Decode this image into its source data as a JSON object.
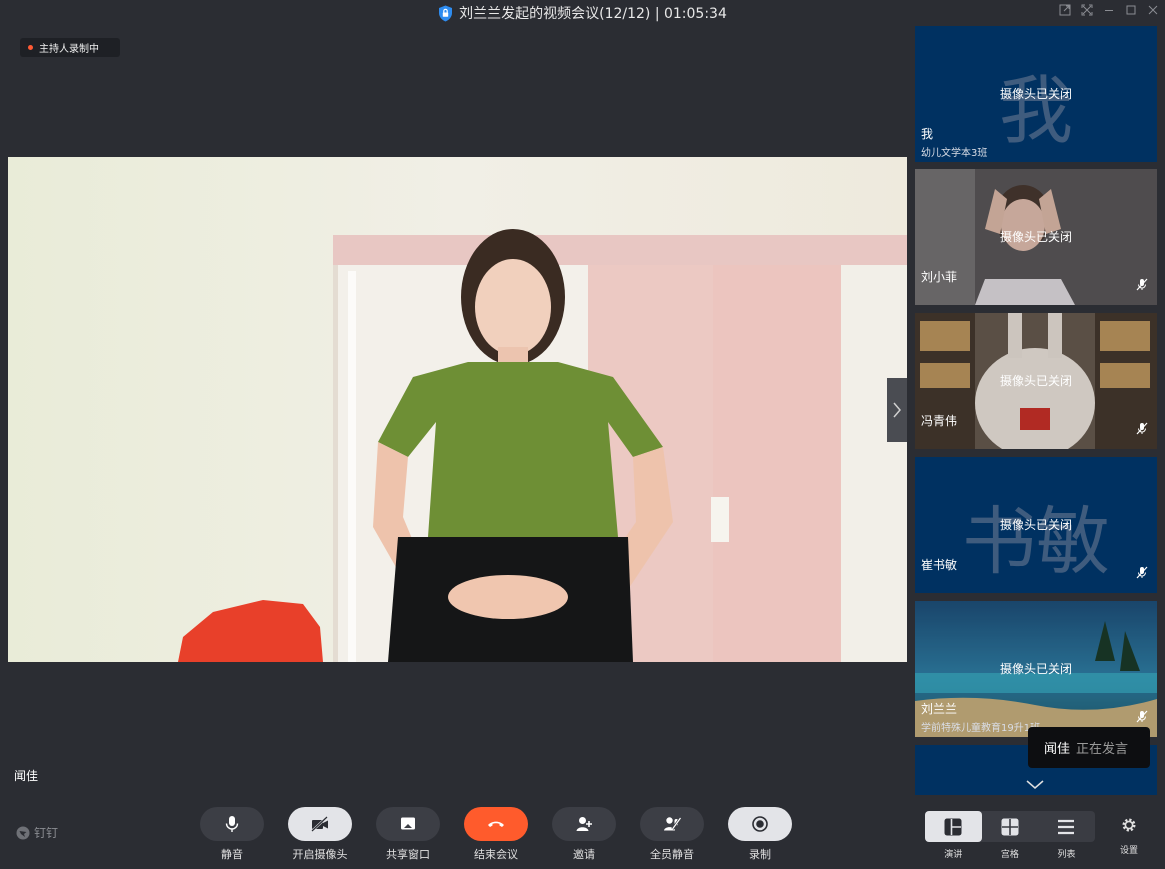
{
  "window": {
    "title": "刘兰兰发起的视频会议(12/12) | 01:05:34"
  },
  "stage": {
    "recording_badge": "主持人录制中",
    "speaker_name": "闻佳"
  },
  "participants": [
    {
      "name": "我",
      "subtitle": "幼儿文学本3班",
      "avatar_text": "我",
      "camera_status": "摄像头已关闭",
      "muted": false
    },
    {
      "name": "刘小菲",
      "subtitle": "",
      "avatar_text": "",
      "camera_status": "摄像头已关闭",
      "muted": true
    },
    {
      "name": "冯青伟",
      "subtitle": "",
      "avatar_text": "",
      "camera_status": "摄像头已关闭",
      "muted": true
    },
    {
      "name": "崔书敏",
      "subtitle": "",
      "avatar_text": "书敏",
      "camera_status": "摄像头已关闭",
      "muted": true
    },
    {
      "name": "刘兰兰",
      "subtitle": "学前特殊儿童教育19升1班",
      "avatar_text": "",
      "camera_status": "摄像头已关闭",
      "muted": true
    }
  ],
  "speaking_toast": {
    "name": "闻佳",
    "status": "正在发言"
  },
  "toolbar": {
    "brand": "钉钉",
    "buttons": [
      {
        "label": "静音",
        "icon": "microphone-icon"
      },
      {
        "label": "开启摄像头",
        "icon": "camera-off-icon"
      },
      {
        "label": "共享窗口",
        "icon": "share-screen-icon"
      },
      {
        "label": "结束会议",
        "icon": "hang-up-icon"
      },
      {
        "label": "邀请",
        "icon": "add-user-icon"
      },
      {
        "label": "全员静音",
        "icon": "mute-all-icon"
      },
      {
        "label": "录制",
        "icon": "record-icon"
      }
    ],
    "views": [
      {
        "label": "演讲",
        "icon": "speaker-layout-icon",
        "active": true
      },
      {
        "label": "宫格",
        "icon": "grid-layout-icon",
        "active": false
      },
      {
        "label": "列表",
        "icon": "list-layout-icon",
        "active": false
      }
    ],
    "settings_label": "设置"
  },
  "colors": {
    "background": "#2b2d33",
    "tile_blue": "#003161",
    "end_call": "#ff5b2c",
    "recording_dot": "#ff5a34"
  }
}
